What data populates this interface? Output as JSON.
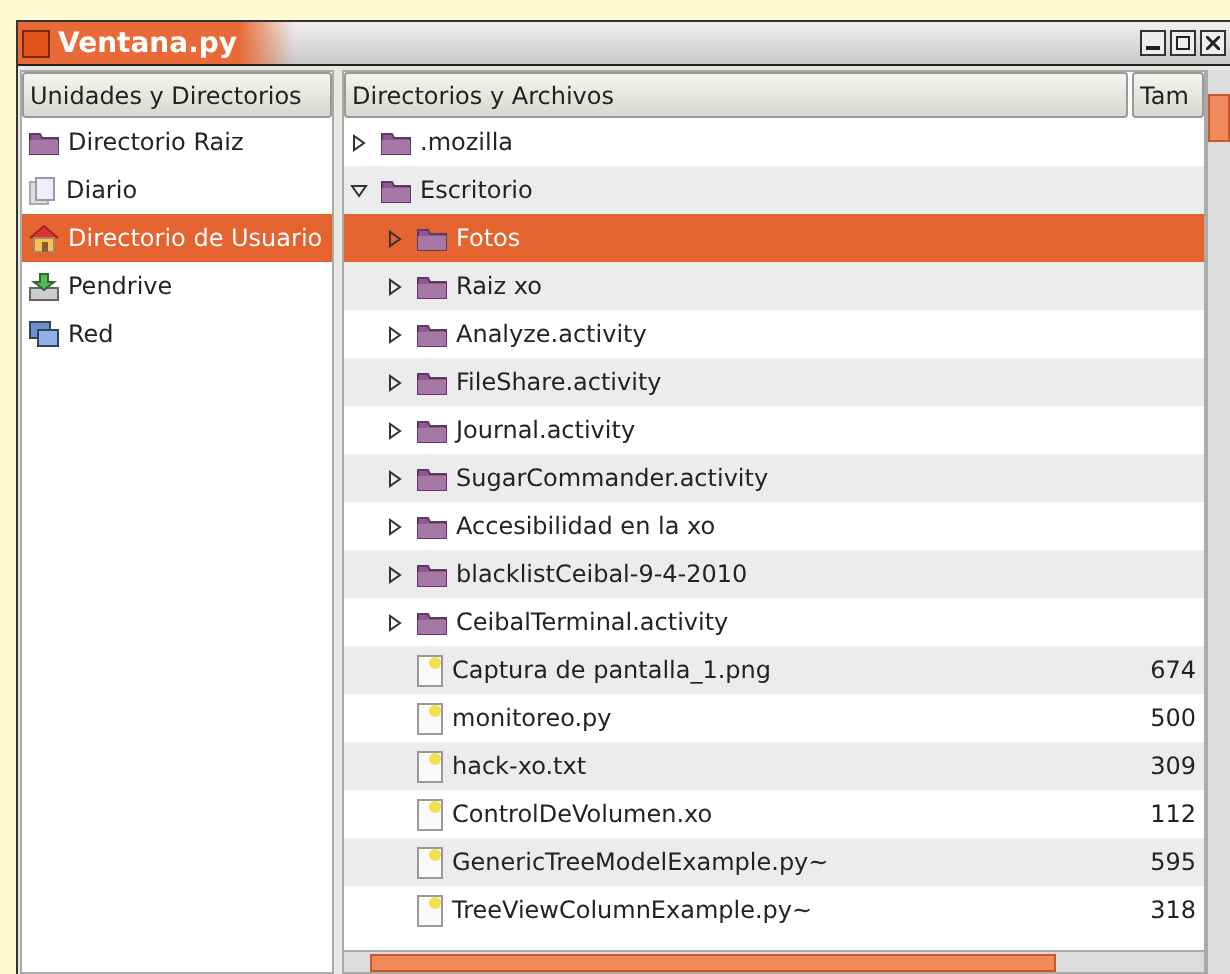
{
  "window": {
    "title": "Ventana.py"
  },
  "sidebar": {
    "header": "Unidades y Directorios",
    "items": [
      {
        "label": "Directorio Raiz",
        "kind": "folder",
        "selected": false
      },
      {
        "label": "Diario",
        "kind": "journal",
        "selected": false
      },
      {
        "label": "Directorio de Usuario",
        "kind": "home",
        "selected": true
      },
      {
        "label": "Pendrive",
        "kind": "drive",
        "selected": false
      },
      {
        "label": "Red",
        "kind": "network",
        "selected": false
      }
    ]
  },
  "files": {
    "columns": [
      "Directorios y Archivos",
      "Tam"
    ],
    "tree": [
      {
        "kind": "folder",
        "name": ".mozilla",
        "expanded": false,
        "selected": false
      },
      {
        "kind": "folder",
        "name": "Escritorio",
        "expanded": true,
        "selected": false,
        "children": [
          {
            "kind": "folder",
            "name": "Fotos",
            "expanded": false,
            "selected": true
          },
          {
            "kind": "folder",
            "name": "Raiz xo",
            "expanded": false,
            "selected": false
          },
          {
            "kind": "folder",
            "name": "Analyze.activity",
            "expanded": false,
            "selected": false
          },
          {
            "kind": "folder",
            "name": "FileShare.activity",
            "expanded": false,
            "selected": false
          },
          {
            "kind": "folder",
            "name": "Journal.activity",
            "expanded": false,
            "selected": false
          },
          {
            "kind": "folder",
            "name": "SugarCommander.activity",
            "expanded": false,
            "selected": false
          },
          {
            "kind": "folder",
            "name": "Accesibilidad en la xo",
            "expanded": false,
            "selected": false
          },
          {
            "kind": "folder",
            "name": "blacklistCeibal-9-4-2010",
            "expanded": false,
            "selected": false
          },
          {
            "kind": "folder",
            "name": "CeibalTerminal.activity",
            "expanded": false,
            "selected": false
          },
          {
            "kind": "file",
            "name": "Captura de pantalla_1.png",
            "size": "674",
            "selected": false
          },
          {
            "kind": "file",
            "name": "monitoreo.py",
            "size": "500",
            "selected": false
          },
          {
            "kind": "file",
            "name": "hack-xo.txt",
            "size": "309",
            "selected": false
          },
          {
            "kind": "file",
            "name": "ControlDeVolumen.xo",
            "size": "112",
            "selected": false
          },
          {
            "kind": "file",
            "name": "GenericTreeModelExample.py~",
            "size": "595",
            "selected": false
          },
          {
            "kind": "file",
            "name": "TreeViewColumnExample.py~",
            "size": "318",
            "selected": false
          }
        ]
      }
    ]
  }
}
